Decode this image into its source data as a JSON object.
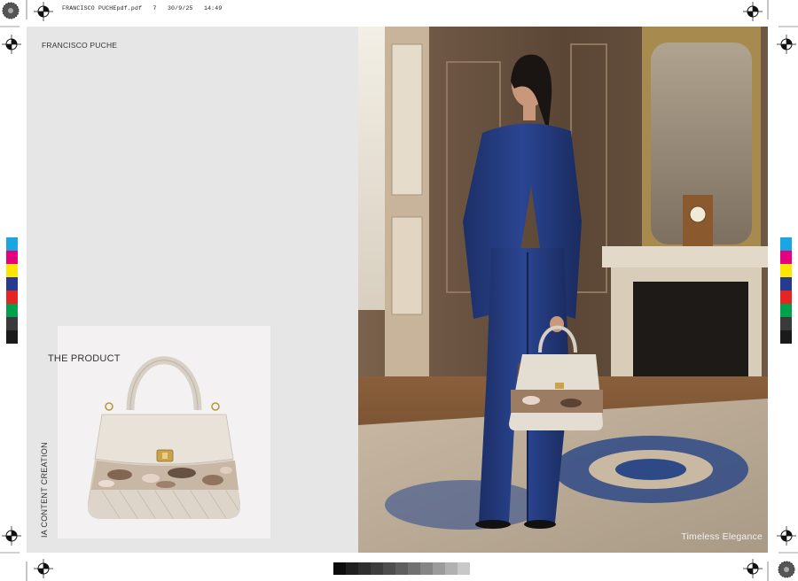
{
  "slug": {
    "filename": "FRANCISCO PUCHEpdf.pdf",
    "page": "7",
    "date": "30/9/25",
    "time": "14:49"
  },
  "left_page": {
    "brand": "FRANCISCO PUCHE",
    "product_title": "THE PRODUCT",
    "side_label": "IA CONTENT CREATION"
  },
  "right_page": {
    "caption": "Timeless Elegance"
  },
  "print_marks": {
    "color_swatches": [
      "#1aa6e0",
      "#e5007e",
      "#ffe600",
      "#283a8f",
      "#e52521",
      "#00a04d",
      "#3a3a3a",
      "#1a1a1a"
    ],
    "gray_steps": [
      "#0c0c0c",
      "#1f1f1f",
      "#2e2e2e",
      "#3d3d3d",
      "#4d4d4d",
      "#5e5e5e",
      "#717171",
      "#858585",
      "#9b9b9b",
      "#b1b1b1",
      "#c8c8c8"
    ]
  }
}
